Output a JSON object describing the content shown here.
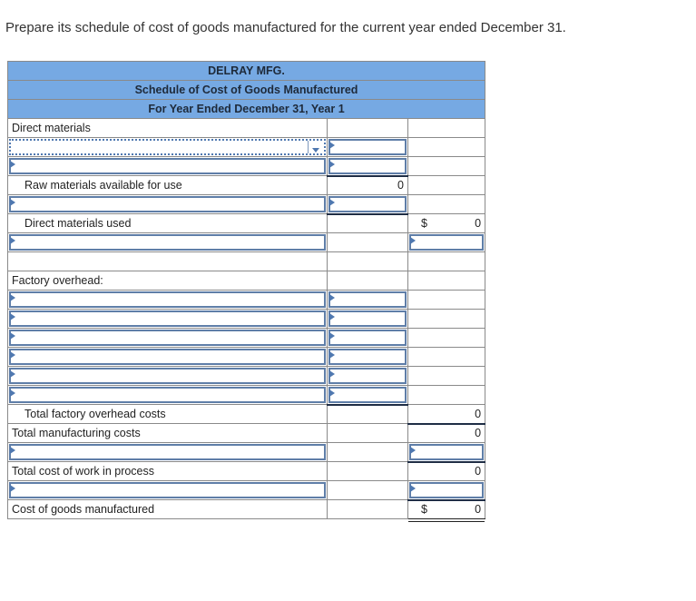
{
  "prompt": "Prepare its schedule of cost of goods manufactured for the current year ended December 31.",
  "header": {
    "company": "DELRAY MFG.",
    "title": "Schedule of Cost of Goods Manufactured",
    "period": "For Year Ended December 31, Year 1"
  },
  "rows": {
    "direct_materials_label": "Direct materials",
    "dropdown_value": "",
    "raw_materials_available_label": "Raw materials available for use",
    "raw_materials_available_value": "0",
    "direct_materials_used_label": "Direct materials used",
    "direct_materials_used_currency": "$",
    "direct_materials_used_value": "0",
    "factory_overhead_label": "Factory overhead:",
    "total_factory_overhead_label": "Total factory overhead costs",
    "total_factory_overhead_value": "0",
    "total_manufacturing_label": "Total manufacturing costs",
    "total_manufacturing_value": "0",
    "total_wip_label": "Total cost of work in process",
    "total_wip_value": "0",
    "cogm_label": "Cost of goods manufactured",
    "cogm_currency": "$",
    "cogm_value": "0"
  },
  "inputs": {
    "empty": ""
  }
}
